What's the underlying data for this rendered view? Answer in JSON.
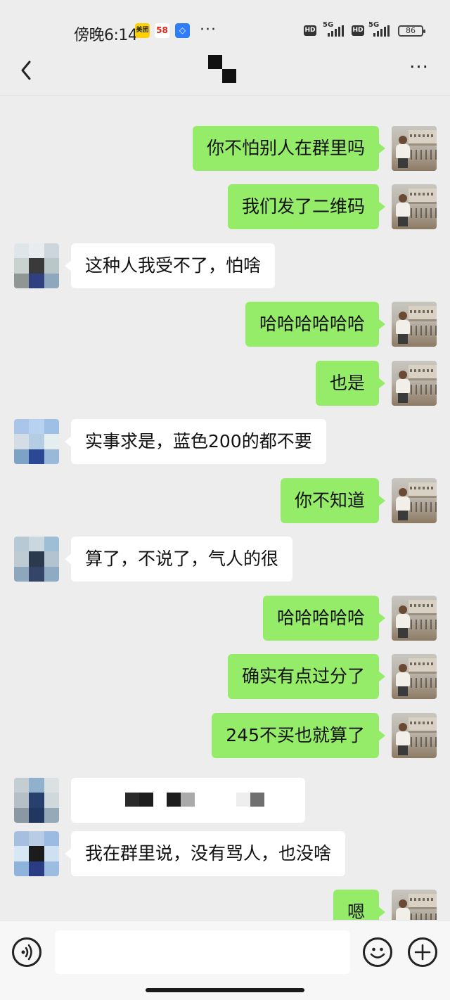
{
  "status_bar": {
    "time": "傍晚6:14",
    "app_icons": [
      "美团",
      "58",
      "◇"
    ],
    "more": "···",
    "network_hd": "HD",
    "network_5g": "5G",
    "battery": "86"
  },
  "nav": {
    "back_icon": "chevron-left-icon",
    "title_logo": "black-squares-logo",
    "more": "···"
  },
  "messages": [
    {
      "side": "out",
      "text": "你不怕别人在群里吗"
    },
    {
      "side": "out",
      "text": "我们发了二维码"
    },
    {
      "side": "in",
      "text": "这种人我受不了，怕啥",
      "avatar": [
        "#dfe6ea",
        "#e8ecef",
        "#cdd6dc",
        "#c9d2cf",
        "#3a3a3a",
        "#b9c7c9",
        "#8f9693",
        "#2f3f7f",
        "#8ea7bc"
      ]
    },
    {
      "side": "out",
      "text": "哈哈哈哈哈哈"
    },
    {
      "side": "out",
      "text": "也是"
    },
    {
      "side": "in",
      "text": "实事求是，蓝色200的都不要",
      "avatar": [
        "#a9c5ea",
        "#b7d1f0",
        "#9fc0e6",
        "#d4dde6",
        "#b4cde3",
        "#e6edef",
        "#7ea1c6",
        "#2c4793",
        "#9ab8d8"
      ]
    },
    {
      "side": "out",
      "text": "你不知道"
    },
    {
      "side": "in",
      "text": "算了，不说了，气人的很",
      "avatar": [
        "#b8c9d6",
        "#c9d7de",
        "#9ebed6",
        "#bfcbd2",
        "#2c3a4d",
        "#b3c3cf",
        "#8ea7bd",
        "#35456a",
        "#8fabc4"
      ]
    },
    {
      "side": "out",
      "text": "哈哈哈哈哈"
    },
    {
      "side": "out",
      "text": "确实有点过分了"
    },
    {
      "side": "out",
      "text": "245不买也就算了"
    },
    {
      "side": "in",
      "text": "",
      "redacted": true,
      "avatar": [
        "#c4cdd2",
        "#8fb1cc",
        "#dbe0e2",
        "#b5c0c6",
        "#27406e",
        "#d1d8dc",
        "#8a98a3",
        "#22375f",
        "#95a9b8"
      ]
    },
    {
      "side": "in",
      "text": "我在群里说，没有骂人，也没啥",
      "avatar": [
        "#a6bfe1",
        "#b9cce6",
        "#9cbbe3",
        "#d7e7f4",
        "#1c1c1c",
        "#cfe0f0",
        "#8fb4db",
        "#2a3d84",
        "#9dbde0"
      ]
    },
    {
      "side": "out",
      "text": "嗯"
    }
  ],
  "input": {
    "voice_icon": "voice-icon",
    "value": "",
    "emoji_icon": "emoji-icon",
    "plus_icon": "plus-icon"
  }
}
